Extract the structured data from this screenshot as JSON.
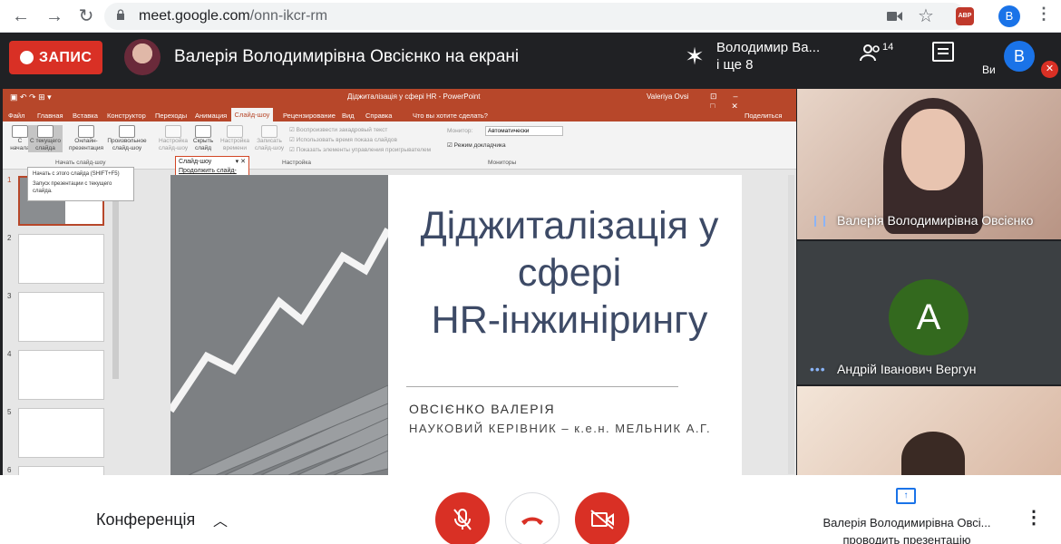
{
  "browser": {
    "url_host": "meet.google.com",
    "url_path": "/onn-ikcr-rm",
    "profile_initial": "B",
    "extension_label": "ABP",
    "icons": [
      "back-icon",
      "forward-icon",
      "reload-icon",
      "lock-icon",
      "camera-icon",
      "star-icon",
      "kebab-icon"
    ]
  },
  "meet_top": {
    "recording_label": "ЗАПИС",
    "title": "Валерія Володимирівна Овсієнко на екрані",
    "pinned_name": "Володимир Ва...",
    "pinned_more": "і ще 8",
    "people_count": "14",
    "self_initial": "B",
    "self_label": "Ви"
  },
  "ppt": {
    "window_title": "Діджиталізація у сфері HR - PowerPoint",
    "user": "Valeriya Ovsi",
    "tabs": [
      "Файл",
      "Главная",
      "Вставка",
      "Конструктор",
      "Переходы",
      "Анимация",
      "Слайд-шоу",
      "Рецензирование",
      "Вид",
      "Справка",
      "Что вы хотите сделать?"
    ],
    "active_tab": "Слайд-шоу",
    "share": "Поделиться",
    "ribbon_buttons": [
      {
        "label": "С начала"
      },
      {
        "label": "С текущего слайда"
      },
      {
        "label": "Онлайн-презентация"
      },
      {
        "label": "Произвольное слайд-шоу"
      },
      {
        "label": "Настройка слайд-шоу"
      },
      {
        "label": "Скрыть слайд"
      },
      {
        "label": "Настройка времени"
      },
      {
        "label": "Записать слайд-шоу"
      }
    ],
    "checkboxes": [
      "Воспроизвести закадровый текст",
      "Использовать время показа слайдов",
      "Показать элементы управления проигрывателем"
    ],
    "monitor_label": "Монитор:",
    "monitor_value": "Автоматически",
    "presenter_mode": "Режим докладчика",
    "groups": [
      "Начать слайд-шоу",
      "Настройка",
      "Мониторы"
    ],
    "tooltip_title": "Начать с этого слайда (SHIFT+F5)",
    "tooltip_body": "Запуск презентации с текущего слайда.",
    "dropdown_title": "Слайд-шоу",
    "dropdown_item": "Продолжить слайд-шоу",
    "thumb_numbers": [
      "1",
      "2",
      "3",
      "4",
      "5",
      "6"
    ]
  },
  "slide": {
    "title_line1": "Діджиталізація у",
    "title_line2": "сфері",
    "title_line3": "HR-інжинірингу",
    "author": "ОВСІЄНКО ВАЛЕРІЯ",
    "supervisor": "НАУКОВИЙ КЕРІВНИК – к.е.н. МЕЛЬНИК А.Г."
  },
  "participants": [
    {
      "name": "Валерія Володимирівна Овсієнко"
    },
    {
      "name": "Андрій Іванович Вергун",
      "initial": "A"
    }
  ],
  "bottom": {
    "conference_label": "Конференція",
    "presenter_name": "Валерія Володимирівна Овсі...",
    "presenter_status": "проводить презентацію"
  },
  "colors": {
    "record": "#d93025",
    "ppt_accent": "#b7472a",
    "meet_dark": "#202124",
    "avatar_green": "#33691e"
  }
}
